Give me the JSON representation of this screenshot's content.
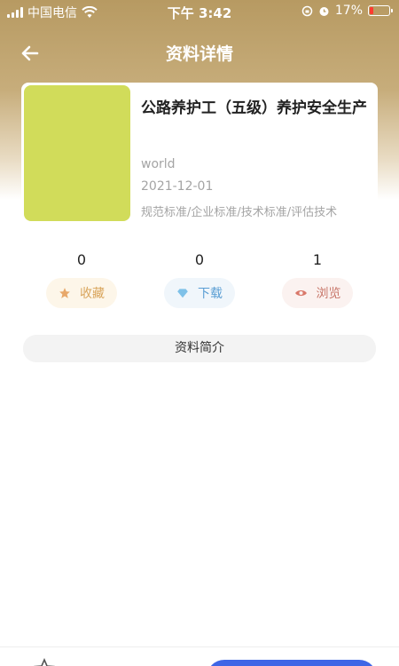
{
  "status_bar": {
    "carrier": "中国电信",
    "time": "下午 3:42",
    "battery_percent": "17%",
    "battery_level": 0.17,
    "battery_color": "#ff3b30"
  },
  "nav": {
    "title": "资料详情",
    "back_icon": "arrow-left-icon"
  },
  "resource": {
    "title": "公路养护工（五级）养护安全生产",
    "author": "world",
    "date": "2021-12-01",
    "tags": "规范标准/企业标准/技术标准/评估技术",
    "thumbnail_color": "#d1dc5a"
  },
  "stats": [
    {
      "count": "0",
      "label": "收藏",
      "icon": "star-icon"
    },
    {
      "count": "0",
      "label": "下载",
      "icon": "diamond-icon"
    },
    {
      "count": "1",
      "label": "浏览",
      "icon": "eye-icon"
    }
  ],
  "intro": {
    "label": "资料简介"
  },
  "colors": {
    "header_gold": "#b79a62",
    "primary_button": "#3e66e6"
  }
}
